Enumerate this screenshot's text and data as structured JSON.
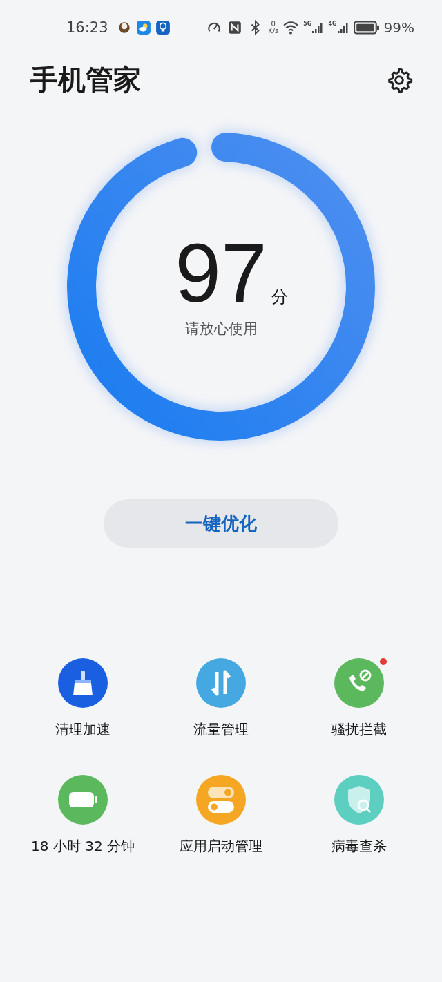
{
  "status_bar": {
    "time": "16:23",
    "net_speed_value": "0",
    "net_speed_unit": "K/s",
    "sim1_type": "5G",
    "sim2_type": "4G",
    "battery": "99%"
  },
  "header": {
    "title": "手机管家"
  },
  "score": {
    "value": "97",
    "unit": "分",
    "caption": "请放心使用",
    "level": 0.97
  },
  "optimize_button": {
    "label": "一键优化"
  },
  "tools": [
    {
      "label": "清理加速",
      "kind": "broom",
      "color": "#1a5fe0",
      "badge": false
    },
    {
      "label": "流量管理",
      "kind": "arrows",
      "color": "#45a8e0",
      "badge": false
    },
    {
      "label": "骚扰拦截",
      "kind": "phone",
      "color": "#5cb85c",
      "badge": true
    },
    {
      "label": "18 小时 32 分钟",
      "kind": "battery",
      "color": "#5cb85c",
      "badge": false
    },
    {
      "label": "应用启动管理",
      "kind": "switches",
      "color": "#f5a623",
      "badge": false
    },
    {
      "label": "病毒查杀",
      "kind": "shield",
      "color": "#5ccfc0",
      "badge": false
    }
  ]
}
